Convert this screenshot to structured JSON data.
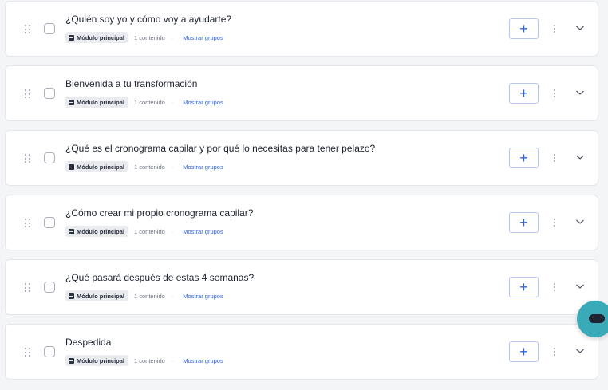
{
  "modules": [
    {
      "title": "¿Quién soy yo y cómo voy a ayudarte?",
      "badge": "Módulo principal",
      "count": "1 contenido",
      "separator": "·",
      "groups_link": "Mostrar grupos"
    },
    {
      "title": "Bienvenida a tu transformación",
      "badge": "Módulo principal",
      "count": "1 contenido",
      "separator": "·",
      "groups_link": "Mostrar grupos"
    },
    {
      "title": "¿Qué es el cronograma capilar y por qué lo necesitas para tener pelazo?",
      "badge": "Módulo principal",
      "count": "1 contenido",
      "separator": "·",
      "groups_link": "Mostrar grupos"
    },
    {
      "title": "¿Cómo crear mi propio cronograma capilar?",
      "badge": "Módulo principal",
      "count": "1 contenido",
      "separator": "·",
      "groups_link": "Mostrar grupos"
    },
    {
      "title": "¿Qué pasará después de estas 4 semanas?",
      "badge": "Módulo principal",
      "count": "1 contenido",
      "separator": "·",
      "groups_link": "Mostrar grupos"
    },
    {
      "title": "Despedida",
      "badge": "Módulo principal",
      "count": "1 contenido",
      "separator": "·",
      "groups_link": "Mostrar grupos"
    }
  ],
  "icons": {
    "drag": "drag-handle-icon",
    "badge": "module-icon",
    "add": "plus-icon",
    "more": "more-vertical-icon",
    "expand": "chevron-down-icon",
    "chat": "chat-bubble-icon"
  },
  "colors": {
    "accent": "#2f63d9",
    "chat_button": "#3aaab8",
    "badge_background": "#e9ebef",
    "card_border": "#e3e6ec"
  }
}
